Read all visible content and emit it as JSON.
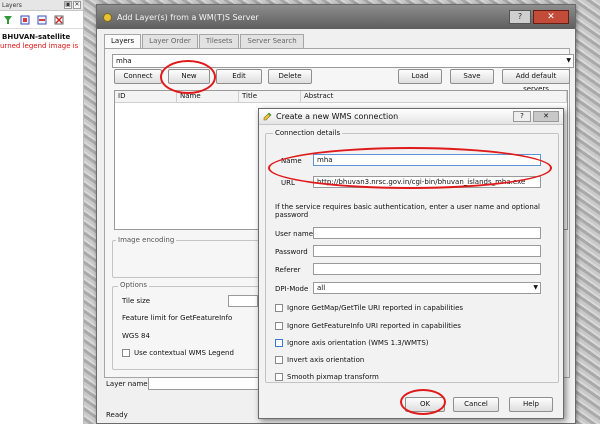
{
  "layers_panel": {
    "title": "Layers",
    "controls": [
      "▣",
      "✕"
    ],
    "layer_name": "BHUVAN-satellite",
    "error_text": "urned legend image is"
  },
  "main_dialog": {
    "title": "Add Layer(s) from a WM(T)S Server",
    "help_btn": "?",
    "close_btn": "✕",
    "tabs": [
      "Layers",
      "Layer Order",
      "Tilesets",
      "Server Search"
    ],
    "connection": "mha",
    "buttons": {
      "connect": "Connect",
      "new": "New",
      "edit": "Edit",
      "delete": "Delete",
      "load": "Load",
      "save": "Save",
      "add_default": "Add default servers"
    },
    "table_headers": [
      "ID",
      "Name",
      "Title",
      "Abstract"
    ],
    "image_encoding": "Image encoding",
    "options": {
      "title": "Options",
      "tile_size": "Tile size",
      "feature_limit": "Feature limit for GetFeatureInfo",
      "crs": "WGS 84",
      "contextual_legend": "Use contextual WMS Legend"
    },
    "layer_name_label": "Layer name",
    "status": "Ready"
  },
  "wms_dialog": {
    "title": "Create a new WMS connection",
    "help_btn": "?",
    "close_btn": "✕",
    "group_title": "Connection details",
    "name_label": "Name",
    "name_value": "mha",
    "url_label": "URL",
    "url_value": "http://bhuvan3.nrsc.gov.in/cgi-bin/bhuvan_islands_mha.exe",
    "auth_note": "If the service requires basic authentication, enter a user name and optional password",
    "user_label": "User name",
    "password_label": "Password",
    "referer_label": "Referer",
    "dpi_label": "DPI-Mode",
    "dpi_value": "all",
    "checkboxes": [
      "Ignore GetMap/GetTile URI reported in capabilities",
      "Ignore GetFeatureInfo URI reported in capabilities",
      "Ignore axis orientation (WMS 1.3/WMTS)",
      "Invert axis orientation",
      "Smooth pixmap transform"
    ],
    "ok": "OK",
    "cancel": "Cancel",
    "help": "Help"
  },
  "colors": {
    "annotation": "#e01a1a",
    "error_text": "#e01010"
  }
}
